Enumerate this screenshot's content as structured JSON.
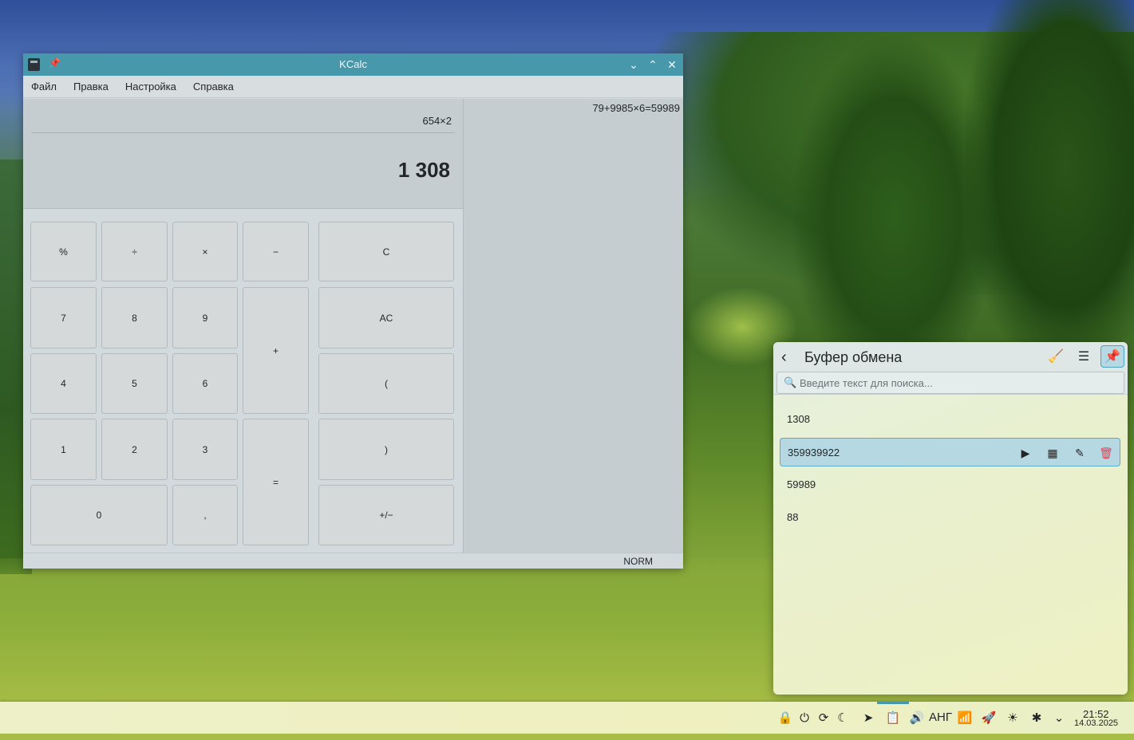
{
  "kcalc": {
    "title": "KCalc",
    "menu": [
      "Файл",
      "Правка",
      "Настройка",
      "Справка"
    ],
    "expression": "654×2",
    "result": "1 308",
    "history_line": "79+9985×6=59989",
    "keys": {
      "percent": "%",
      "divide": "÷",
      "multiply": "×",
      "minus": "−",
      "clear": "C",
      "k7": "7",
      "k8": "8",
      "k9": "9",
      "plus": "+",
      "all_clear": "AC",
      "k4": "4",
      "k5": "5",
      "k6": "6",
      "paren_open": "(",
      "k1": "1",
      "k2": "2",
      "k3": "3",
      "equals": "=",
      "paren_close": ")",
      "k0": "0",
      "decimal": ",",
      "sign": "+/−"
    },
    "status": "NORM",
    "title_buttons": {
      "minimize": "⌄",
      "maximize": "⌃",
      "close": "✕"
    }
  },
  "clipboard": {
    "title": "Буфер обмена",
    "search_placeholder": "Введите текст для поиска...",
    "items": [
      "1308",
      "359939922",
      "59989",
      "88"
    ],
    "selected_index": 1
  },
  "panel": {
    "language": "АНГ",
    "time": "21:52",
    "date": "14.03.2025"
  },
  "colors": {
    "titlebar": "#4698aa",
    "accent": "#4aa3c1",
    "delete": "#da4453"
  }
}
